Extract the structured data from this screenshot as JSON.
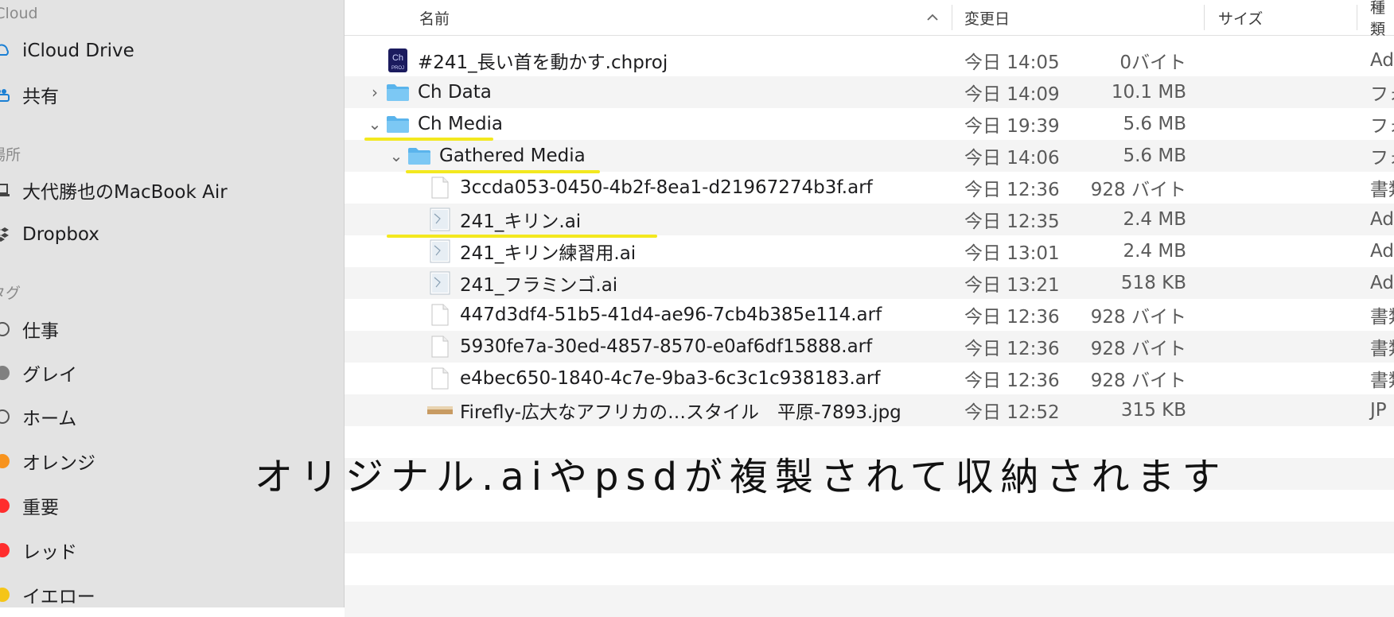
{
  "sidebar": {
    "section_icloud": "iCloud",
    "icloud_drive": "iCloud Drive",
    "shared": "共有",
    "section_locations": "場所",
    "macbook": "大代勝也のMacBook Air",
    "dropbox": "Dropbox",
    "section_tags": "タグ",
    "tags": [
      {
        "label": "仕事",
        "color": "",
        "style": "ring"
      },
      {
        "label": "グレイ",
        "color": "#808080",
        "style": "dot"
      },
      {
        "label": "ホーム",
        "color": "",
        "style": "ring"
      },
      {
        "label": "オレンジ",
        "color": "#f7931e",
        "style": "dot"
      },
      {
        "label": "重要",
        "color": "#ff2d2d",
        "style": "dot"
      },
      {
        "label": "レッド",
        "color": "#ff2d2d",
        "style": "dot"
      },
      {
        "label": "イエロー",
        "color": "#f5c518",
        "style": "dot"
      }
    ]
  },
  "header": {
    "name": "名前",
    "date_modified": "変更日",
    "size": "サイズ",
    "kind": "種類",
    "sort_icon": "chevron-up-icon"
  },
  "files": [
    {
      "name": "#241_長い首を動かす.chproj",
      "date": "今日 14:05",
      "size": "0バイト",
      "kind": "Ad",
      "icon": "chproj-icon",
      "indent": 0,
      "disclosure": ""
    },
    {
      "name": "Ch Data",
      "date": "今日 14:09",
      "size": "10.1 MB",
      "kind": "フォ",
      "icon": "folder-icon",
      "indent": 0,
      "disclosure": "›"
    },
    {
      "name": "Ch Media",
      "date": "今日 19:39",
      "size": "5.6 MB",
      "kind": "フォ",
      "icon": "folder-icon",
      "indent": 0,
      "disclosure": "⌄"
    },
    {
      "name": "Gathered Media",
      "date": "今日 14:06",
      "size": "5.6 MB",
      "kind": "フォ",
      "icon": "folder-icon",
      "indent": 1,
      "disclosure": "⌄"
    },
    {
      "name": "3ccda053-0450-4b2f-8ea1-d21967274b3f.arf",
      "date": "今日 12:36",
      "size": "928 バイト",
      "kind": "書類",
      "icon": "document-icon",
      "indent": 2,
      "disclosure": ""
    },
    {
      "name": "241_キリン.ai",
      "date": "今日 12:35",
      "size": "2.4 MB",
      "kind": "Ad",
      "icon": "ai-file-icon",
      "indent": 2,
      "disclosure": ""
    },
    {
      "name": "241_キリン練習用.ai",
      "date": "今日 13:01",
      "size": "2.4 MB",
      "kind": "Ad",
      "icon": "ai-file-icon",
      "indent": 2,
      "disclosure": ""
    },
    {
      "name": "241_フラミンゴ.ai",
      "date": "今日 13:21",
      "size": "518 KB",
      "kind": "Ad",
      "icon": "ai-file-icon",
      "indent": 2,
      "disclosure": ""
    },
    {
      "name": "447d3df4-51b5-41d4-ae96-7cb4b385e114.arf",
      "date": "今日 12:36",
      "size": "928 バイト",
      "kind": "書類",
      "icon": "document-icon",
      "indent": 2,
      "disclosure": ""
    },
    {
      "name": "5930fe7a-30ed-4857-8570-e0af6df15888.arf",
      "date": "今日 12:36",
      "size": "928 バイト",
      "kind": "書類",
      "icon": "document-icon",
      "indent": 2,
      "disclosure": ""
    },
    {
      "name": "e4bec650-1840-4c7e-9ba3-6c3c1c938183.arf",
      "date": "今日 12:36",
      "size": "928 バイト",
      "kind": "書類",
      "icon": "document-icon",
      "indent": 2,
      "disclosure": ""
    },
    {
      "name": "Firefly-広大なアフリカの…スタイル　平原-7893.jpg",
      "date": "今日 12:52",
      "size": "315 KB",
      "kind": "JP",
      "icon": "image-thumbnail-icon",
      "indent": 2,
      "disclosure": ""
    }
  ],
  "caption": "オリジナル.aiやpsdが複製されて収納されます",
  "accent": {
    "folder": "#5ab4ec",
    "highlight": "#f3e81f"
  }
}
